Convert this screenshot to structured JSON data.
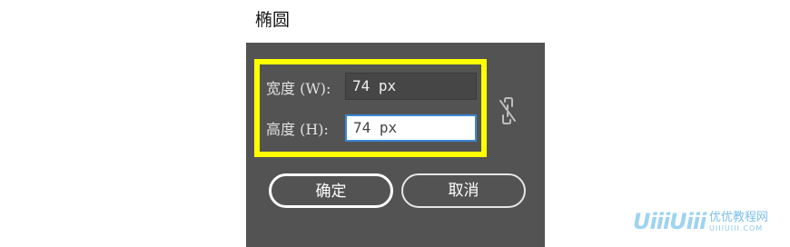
{
  "dialog": {
    "title": "椭圆",
    "width_label": "宽度 (W):",
    "width_value": "74 px",
    "height_label": "高度 (H):",
    "height_value": "74 px",
    "link_icon": "unlink-chain-icon",
    "ok_label": "确定",
    "cancel_label": "取消"
  },
  "colors": {
    "dialog_bg": "#535353",
    "highlight": "#ffff00",
    "focus_border": "#3b87d8"
  },
  "watermark": {
    "logo": "UiiiUiii",
    "text": "优优教程网",
    "url": "UIIIUIII.COM"
  }
}
